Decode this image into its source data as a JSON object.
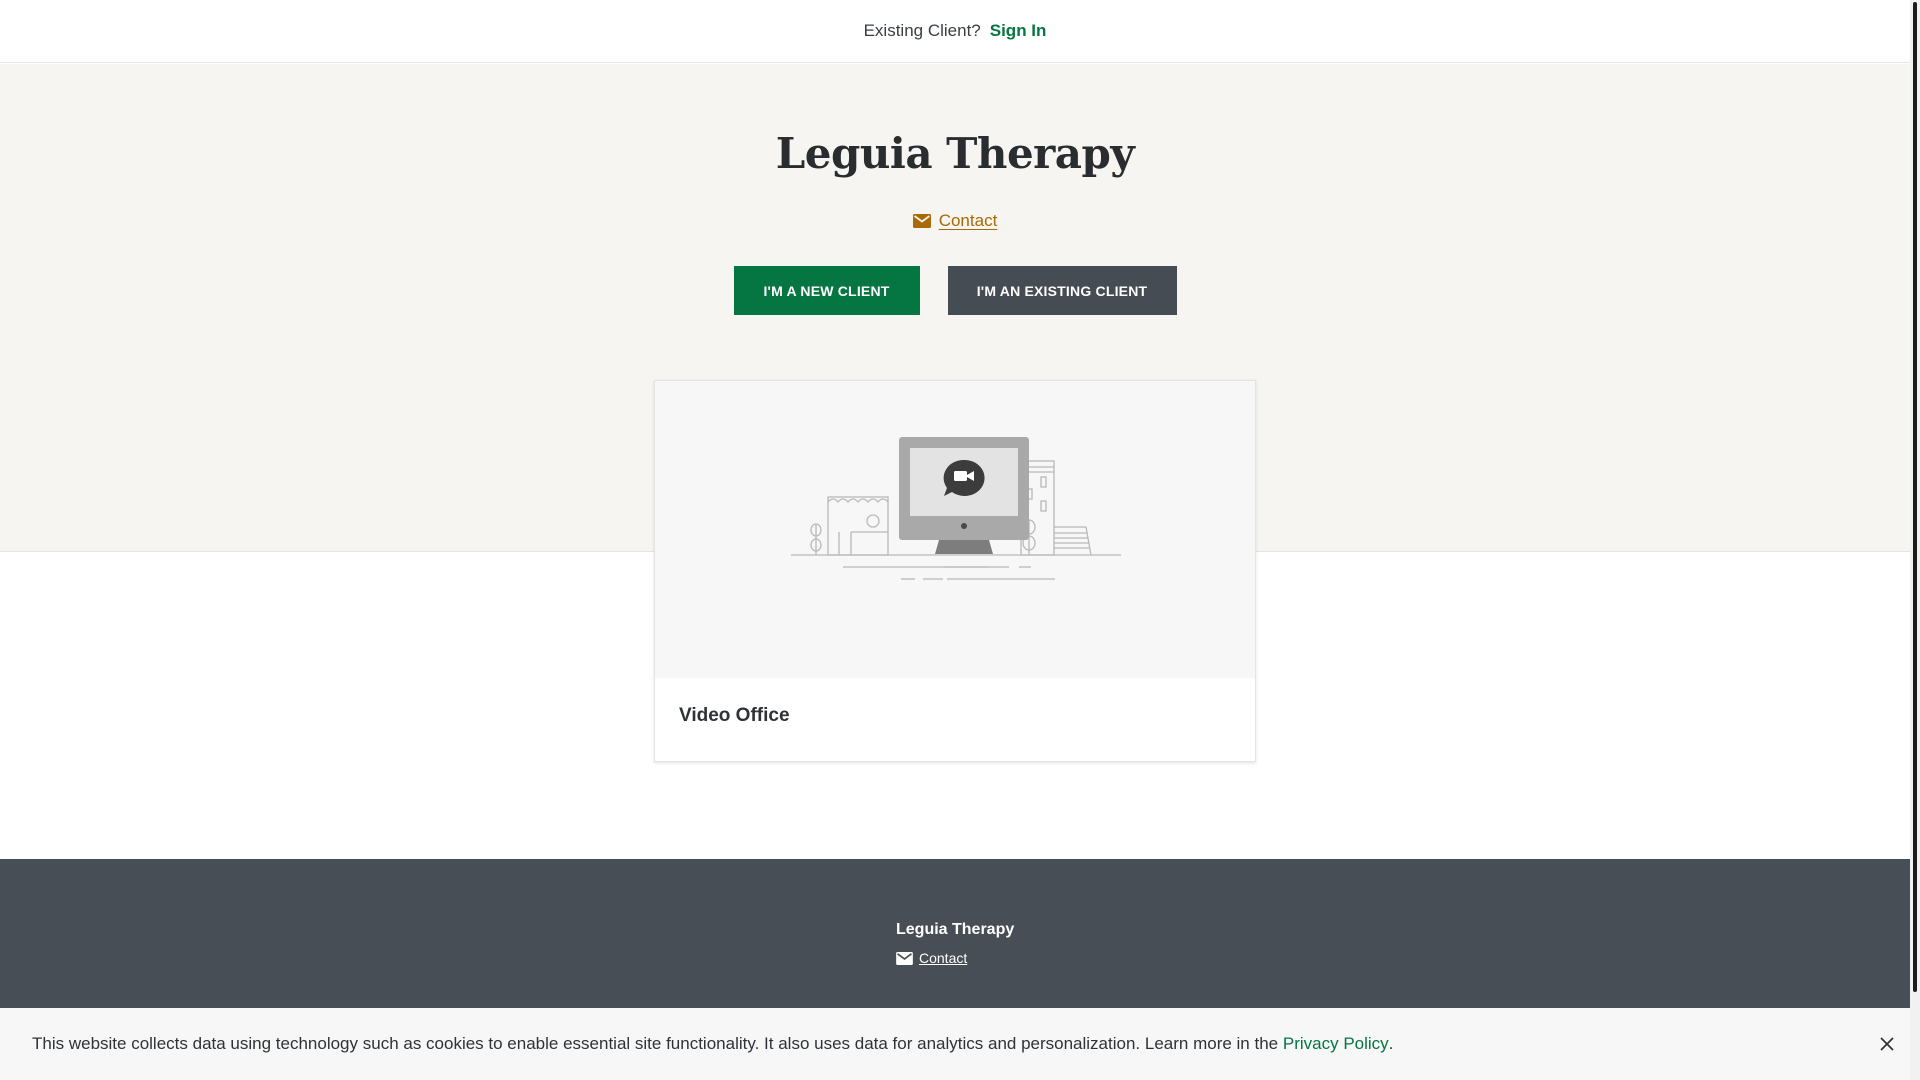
{
  "topbar": {
    "question": "Existing Client?",
    "signin_label": "Sign In"
  },
  "hero": {
    "title": "Leguia Therapy",
    "contact_label": "Contact",
    "new_client_label": "I'M A NEW CLIENT",
    "existing_client_label": "I'M AN EXISTING CLIENT"
  },
  "card": {
    "title": "Video Office",
    "image_icon": "video-office-illustration"
  },
  "footer": {
    "name": "Leguia Therapy",
    "contact_label": "Contact"
  },
  "cookie": {
    "text": "This website collects data using technology such as cookies to enable essential site functionality. It also uses data for analytics and personalization. Learn more in the",
    "link_label": "Privacy Policy",
    "suffix": "."
  },
  "colors": {
    "brand_green": "#057642",
    "dark_slate": "#464c53",
    "contact_gold": "#a86a07",
    "hero_bg": "#f6f5f1",
    "footer_bg": "#474e55"
  }
}
